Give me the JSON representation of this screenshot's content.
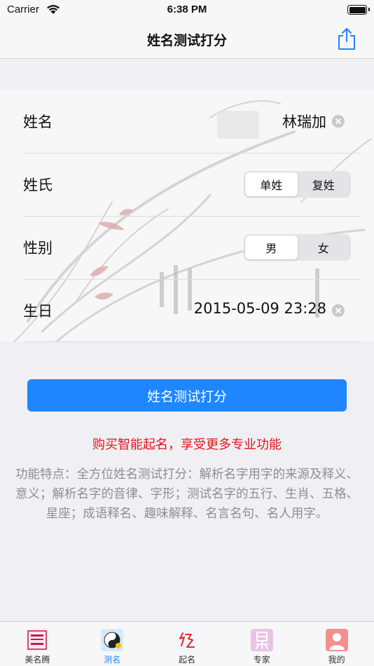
{
  "status_bar": {
    "carrier": "Carrier",
    "time": "6:38 PM"
  },
  "nav": {
    "title": "姓名测试打分"
  },
  "form": {
    "name": {
      "label": "姓名",
      "value": "林瑞加"
    },
    "surname_type": {
      "label": "姓氏",
      "options": [
        "单姓",
        "复姓"
      ],
      "selected": "单姓"
    },
    "gender": {
      "label": "性别",
      "options": [
        "男",
        "女"
      ],
      "selected": "男"
    },
    "birthday": {
      "label": "生日",
      "value": "2015-05-09 23:28"
    }
  },
  "primary_button": {
    "label": "姓名测试打分"
  },
  "promo": {
    "text": "购买智能起名，享受更多专业功能"
  },
  "features": {
    "text": "功能特点：全方位姓名测试打分：解析名字用字的来源及释义、意义；解析名字的音律、字形；测试名字的五行、生肖、五格、星座；成语释名、趣味解释、名言名句、名人用字。"
  },
  "tabs": [
    {
      "label": "美名腾",
      "icon": "meimingteng-logo-icon",
      "active": false
    },
    {
      "label": "测名",
      "icon": "yinyang-icon",
      "active": true
    },
    {
      "label": "起名",
      "icon": "naming-icon",
      "active": false
    },
    {
      "label": "专家",
      "icon": "expert-icon",
      "active": false
    },
    {
      "label": "我的",
      "icon": "profile-icon",
      "active": false
    }
  ],
  "colors": {
    "accent": "#1e86ff",
    "promo": "#e0161a",
    "muted": "#8e8e93",
    "background": "#efeff4"
  }
}
